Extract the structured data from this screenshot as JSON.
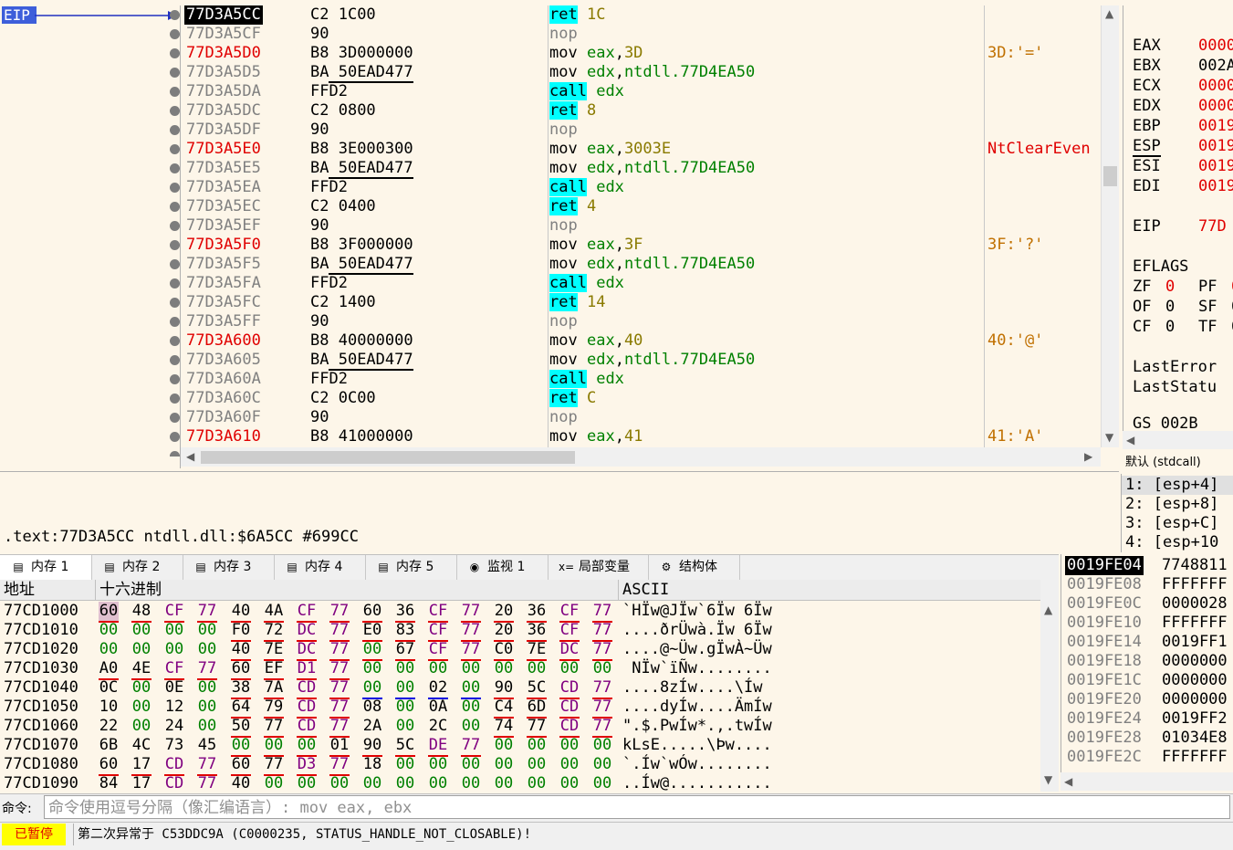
{
  "eip_label": "EIP",
  "disasm": [
    {
      "addr": "77D3A5CC",
      "style": "sel",
      "bytes": "C2 1C00",
      "bul": false,
      "mn": "ret",
      "mnStyle": "cyan",
      "ops": "1C",
      "opStyle": "olive",
      "cmt": ""
    },
    {
      "addr": "77D3A5CF",
      "style": "gray",
      "bytes": "90",
      "bul": false,
      "mn": "nop",
      "mnStyle": "gray",
      "ops": "",
      "opStyle": "",
      "cmt": ""
    },
    {
      "addr": "77D3A5D0",
      "style": "red",
      "bytes": "B8 3D000000",
      "bul": false,
      "mn": "mov",
      "mnStyle": "plain",
      "ops": "eax,3D",
      "opStyle": "mixed",
      "cmt": "3D:'='",
      "cmtStyle": "olive"
    },
    {
      "addr": "77D3A5D5",
      "style": "gray",
      "bytes": "BA 50EAD477",
      "bul": true,
      "mn": "mov",
      "mnStyle": "plain",
      "ops": "edx,ntdll.77D4EA50",
      "opStyle": "mixed",
      "cmt": ""
    },
    {
      "addr": "77D3A5DA",
      "style": "gray",
      "bytes": "FFD2",
      "bul": false,
      "mn": "call",
      "mnStyle": "cyan",
      "ops": "edx",
      "opStyle": "grn",
      "cmt": ""
    },
    {
      "addr": "77D3A5DC",
      "style": "gray",
      "bytes": "C2 0800",
      "bul": false,
      "mn": "ret",
      "mnStyle": "cyan",
      "ops": "8",
      "opStyle": "olive",
      "cmt": ""
    },
    {
      "addr": "77D3A5DF",
      "style": "gray",
      "bytes": "90",
      "bul": false,
      "mn": "nop",
      "mnStyle": "gray",
      "ops": "",
      "opStyle": "",
      "cmt": ""
    },
    {
      "addr": "77D3A5E0",
      "style": "red",
      "bytes": "B8 3E000300",
      "bul": false,
      "mn": "mov",
      "mnStyle": "plain",
      "ops": "eax,3003E",
      "opStyle": "mixed",
      "cmt": "NtClearEven",
      "cmtStyle": "red"
    },
    {
      "addr": "77D3A5E5",
      "style": "gray",
      "bytes": "BA 50EAD477",
      "bul": true,
      "mn": "mov",
      "mnStyle": "plain",
      "ops": "edx,ntdll.77D4EA50",
      "opStyle": "mixed",
      "cmt": ""
    },
    {
      "addr": "77D3A5EA",
      "style": "gray",
      "bytes": "FFD2",
      "bul": false,
      "mn": "call",
      "mnStyle": "cyan",
      "ops": "edx",
      "opStyle": "grn",
      "cmt": ""
    },
    {
      "addr": "77D3A5EC",
      "style": "gray",
      "bytes": "C2 0400",
      "bul": false,
      "mn": "ret",
      "mnStyle": "cyan",
      "ops": "4",
      "opStyle": "olive",
      "cmt": ""
    },
    {
      "addr": "77D3A5EF",
      "style": "gray",
      "bytes": "90",
      "bul": false,
      "mn": "nop",
      "mnStyle": "gray",
      "ops": "",
      "opStyle": "",
      "cmt": ""
    },
    {
      "addr": "77D3A5F0",
      "style": "red",
      "bytes": "B8 3F000000",
      "bul": false,
      "mn": "mov",
      "mnStyle": "plain",
      "ops": "eax,3F",
      "opStyle": "mixed",
      "cmt": "3F:'?'",
      "cmtStyle": "olive"
    },
    {
      "addr": "77D3A5F5",
      "style": "gray",
      "bytes": "BA 50EAD477",
      "bul": true,
      "mn": "mov",
      "mnStyle": "plain",
      "ops": "edx,ntdll.77D4EA50",
      "opStyle": "mixed",
      "cmt": ""
    },
    {
      "addr": "77D3A5FA",
      "style": "gray",
      "bytes": "FFD2",
      "bul": false,
      "mn": "call",
      "mnStyle": "cyan",
      "ops": "edx",
      "opStyle": "grn",
      "cmt": ""
    },
    {
      "addr": "77D3A5FC",
      "style": "gray",
      "bytes": "C2 1400",
      "bul": false,
      "mn": "ret",
      "mnStyle": "cyan",
      "ops": "14",
      "opStyle": "olive",
      "cmt": ""
    },
    {
      "addr": "77D3A5FF",
      "style": "gray",
      "bytes": "90",
      "bul": false,
      "mn": "nop",
      "mnStyle": "gray",
      "ops": "",
      "opStyle": "",
      "cmt": ""
    },
    {
      "addr": "77D3A600",
      "style": "red",
      "bytes": "B8 40000000",
      "bul": false,
      "mn": "mov",
      "mnStyle": "plain",
      "ops": "eax,40",
      "opStyle": "mixed",
      "cmt": "40:'@'",
      "cmtStyle": "olive"
    },
    {
      "addr": "77D3A605",
      "style": "gray",
      "bytes": "BA 50EAD477",
      "bul": true,
      "mn": "mov",
      "mnStyle": "plain",
      "ops": "edx,ntdll.77D4EA50",
      "opStyle": "mixed",
      "cmt": ""
    },
    {
      "addr": "77D3A60A",
      "style": "gray",
      "bytes": "FFD2",
      "bul": false,
      "mn": "call",
      "mnStyle": "cyan",
      "ops": "edx",
      "opStyle": "grn",
      "cmt": ""
    },
    {
      "addr": "77D3A60C",
      "style": "gray",
      "bytes": "C2 0C00",
      "bul": false,
      "mn": "ret",
      "mnStyle": "cyan",
      "ops": "C",
      "opStyle": "olive",
      "cmt": ""
    },
    {
      "addr": "77D3A60F",
      "style": "gray",
      "bytes": "90",
      "bul": false,
      "mn": "nop",
      "mnStyle": "gray",
      "ops": "",
      "opStyle": "",
      "cmt": ""
    },
    {
      "addr": "77D3A610",
      "style": "red",
      "bytes": "B8 41000000",
      "bul": false,
      "mn": "mov",
      "mnStyle": "plain",
      "ops": "eax,41",
      "opStyle": "mixed",
      "cmt": "41:'A'",
      "cmtStyle": "olive"
    }
  ],
  "registers": [
    {
      "name": "EAX",
      "value": "0000",
      "red": true
    },
    {
      "name": "EBX",
      "value": "002A",
      "red": false
    },
    {
      "name": "ECX",
      "value": "0000",
      "red": true
    },
    {
      "name": "EDX",
      "value": "0000",
      "red": true
    },
    {
      "name": "EBP",
      "value": "0019",
      "red": true
    },
    {
      "name": "ESP",
      "value": "0019",
      "red": true,
      "ul": true
    },
    {
      "name": "ESI",
      "value": "0019",
      "red": true
    },
    {
      "name": "EDI",
      "value": "0019",
      "red": true
    }
  ],
  "eip_reg": {
    "name": "EIP",
    "value": "77D"
  },
  "eflags_label": "EFLAGS",
  "eflags_value": "0",
  "flags": [
    [
      {
        "n": "ZF",
        "v": "0",
        "red": true
      },
      {
        "n": "PF",
        "v": "0",
        "red": true
      }
    ],
    [
      {
        "n": "OF",
        "v": "0",
        "red": false
      },
      {
        "n": "SF",
        "v": "0",
        "red": false
      }
    ],
    [
      {
        "n": "CF",
        "v": "0",
        "red": false
      },
      {
        "n": "TF",
        "v": "0",
        "red": false
      }
    ]
  ],
  "last_error": "LastError",
  "last_status": "LastStatu",
  "gs_line": "GS 002B",
  "call_convention": "默认 (stdcall)",
  "stack_args": [
    "1: [esp+4]",
    "2: [esp+8]",
    "3: [esp+C]",
    "4: [esp+10"
  ],
  "info_text": ".text:77D3A5CC ntdll.dll:$6A5CC #699CC",
  "tabs": [
    {
      "label": "内存 1",
      "icon": "memory-icon",
      "active": true
    },
    {
      "label": "内存 2",
      "icon": "memory-icon"
    },
    {
      "label": "内存 3",
      "icon": "memory-icon"
    },
    {
      "label": "内存 4",
      "icon": "memory-icon"
    },
    {
      "label": "内存 5",
      "icon": "memory-icon"
    },
    {
      "label": "监视 1",
      "icon": "watch-icon"
    },
    {
      "label": "局部变量",
      "icon": "locals-icon"
    },
    {
      "label": "结构体",
      "icon": "struct-icon"
    }
  ],
  "dump_headers": {
    "addr": "地址",
    "hex": "十六进制",
    "ascii": "ASCII"
  },
  "dump": [
    {
      "addr": "77CD1000",
      "hex": [
        "60",
        "48",
        "CF",
        "77",
        "40",
        "4A",
        "CF",
        "77",
        "60",
        "36",
        "CF",
        "77",
        "20",
        "36",
        "CF",
        "77"
      ],
      "ascii": "`HÏw@JÏw`6Ïw 6Ïw",
      "ul": [
        1,
        1,
        1,
        1
      ],
      "hl0": true
    },
    {
      "addr": "77CD1010",
      "hex": [
        "00",
        "00",
        "00",
        "00",
        "F0",
        "72",
        "DC",
        "77",
        "E0",
        "83",
        "CF",
        "77",
        "20",
        "36",
        "CF",
        "77"
      ],
      "ascii": "....ðrÜwà.Ïw 6Ïw",
      "ul": [
        0,
        1,
        1,
        1
      ]
    },
    {
      "addr": "77CD1020",
      "hex": [
        "00",
        "00",
        "00",
        "00",
        "40",
        "7E",
        "DC",
        "77",
        "00",
        "67",
        "CF",
        "77",
        "C0",
        "7E",
        "DC",
        "77"
      ],
      "ascii": "....@~Üw.gÏwÀ~Üw",
      "ul": [
        0,
        1,
        1,
        1
      ]
    },
    {
      "addr": "77CD1030",
      "hex": [
        "A0",
        "4E",
        "CF",
        "77",
        "60",
        "EF",
        "D1",
        "77",
        "00",
        "00",
        "00",
        "00",
        "00",
        "00",
        "00",
        "00"
      ],
      "ascii": " NÏw`ïÑw........",
      "ul": [
        1,
        1,
        0,
        0
      ]
    },
    {
      "addr": "77CD1040",
      "hex": [
        "0C",
        "00",
        "0E",
        "00",
        "38",
        "7A",
        "CD",
        "77",
        "00",
        "00",
        "02",
        "00",
        "90",
        "5C",
        "CD",
        "77"
      ],
      "ascii": "....8zÍw....\\Íw",
      "ul": [
        0,
        1,
        2,
        1
      ]
    },
    {
      "addr": "77CD1050",
      "hex": [
        "10",
        "00",
        "12",
        "00",
        "64",
        "79",
        "CD",
        "77",
        "08",
        "00",
        "0A",
        "00",
        "C4",
        "6D",
        "CD",
        "77"
      ],
      "ascii": "....dyÍw....ÄmÍw",
      "ul": [
        0,
        1,
        0,
        1
      ]
    },
    {
      "addr": "77CD1060",
      "hex": [
        "22",
        "00",
        "24",
        "00",
        "50",
        "77",
        "CD",
        "77",
        "2A",
        "00",
        "2C",
        "00",
        "74",
        "77",
        "CD",
        "77"
      ],
      "ascii": "\".$.PwÍw*.,.twÍw",
      "ul": [
        0,
        1,
        0,
        1
      ]
    },
    {
      "addr": "77CD1070",
      "hex": [
        "6B",
        "4C",
        "73",
        "45",
        "00",
        "00",
        "00",
        "01",
        "90",
        "5C",
        "DE",
        "77",
        "00",
        "00",
        "00",
        "00"
      ],
      "ascii": "kLsE.....\\Þw....",
      "ul": [
        0,
        1,
        1,
        0
      ]
    },
    {
      "addr": "77CD1080",
      "hex": [
        "60",
        "17",
        "CD",
        "77",
        "60",
        "77",
        "D3",
        "77",
        "18",
        "00",
        "00",
        "00",
        "00",
        "00",
        "00",
        "00"
      ],
      "ascii": "`.Íw`wÓw........",
      "ul": [
        1,
        1,
        0,
        0
      ]
    },
    {
      "addr": "77CD1090",
      "hex": [
        "84",
        "17",
        "CD",
        "77",
        "40",
        "00",
        "00",
        "00",
        "00",
        "00",
        "00",
        "00",
        "00",
        "00",
        "00",
        "00"
      ],
      "ascii": "..Íw@...........",
      "ul": [
        1,
        0,
        0,
        0
      ]
    }
  ],
  "stack": [
    {
      "addr": "0019FE04",
      "val": "7748811",
      "cur": true
    },
    {
      "addr": "0019FE08",
      "val": "FFFFFFF"
    },
    {
      "addr": "0019FE0C",
      "val": "0000028"
    },
    {
      "addr": "0019FE10",
      "val": "FFFFFFF"
    },
    {
      "addr": "0019FE14",
      "val": "0019FF1"
    },
    {
      "addr": "0019FE18",
      "val": "0000000"
    },
    {
      "addr": "0019FE1C",
      "val": "0000000"
    },
    {
      "addr": "0019FE20",
      "val": "0000000"
    },
    {
      "addr": "0019FE24",
      "val": "0019FF2"
    },
    {
      "addr": "0019FE28",
      "val": "01034E8"
    },
    {
      "addr": "0019FE2C",
      "val": "FFFFFFF"
    }
  ],
  "cmd_label": "命令:",
  "cmd_placeholder": "命令使用逗号分隔（像汇编语言）: mov eax, ebx",
  "status_badge": "已暂停",
  "status_message": "第二次异常于 C53DDC9A (C0000235, STATUS_HANDLE_NOT_CLOSABLE)!"
}
